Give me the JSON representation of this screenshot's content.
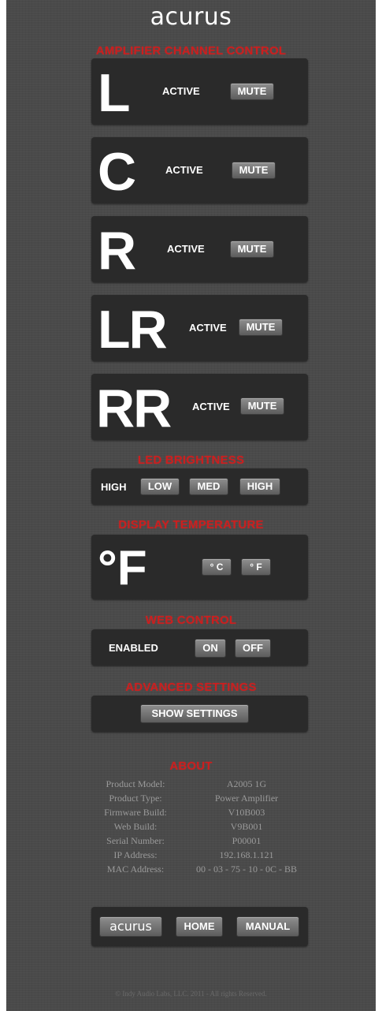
{
  "header": {
    "logo_text": "acurus"
  },
  "amplifier": {
    "title": "AMPLIFIER CHANNEL CONTROL",
    "channels": [
      {
        "label": "L",
        "status": "ACTIVE",
        "mute_label": "MUTE"
      },
      {
        "label": "C",
        "status": "ACTIVE",
        "mute_label": "MUTE"
      },
      {
        "label": "R",
        "status": "ACTIVE",
        "mute_label": "MUTE"
      },
      {
        "label": "LR",
        "status": "ACTIVE",
        "mute_label": "MUTE"
      },
      {
        "label": "RR",
        "status": "ACTIVE",
        "mute_label": "MUTE"
      }
    ]
  },
  "led": {
    "title": "LED BRIGHTNESS",
    "current": "HIGH",
    "options": [
      "LOW",
      "MED",
      "HIGH"
    ]
  },
  "temperature": {
    "title": "DISPLAY TEMPERATURE",
    "current": "°F",
    "celsius_label": "° C",
    "fahrenheit_label": "° F"
  },
  "web_control": {
    "title": "WEB CONTROL",
    "status": "ENABLED",
    "on_label": "ON",
    "off_label": "OFF"
  },
  "advanced": {
    "title": "ADVANCED SETTINGS",
    "button_label": "SHOW SETTINGS"
  },
  "about": {
    "title": "ABOUT",
    "rows": [
      {
        "label": "Product Model:",
        "value": "A2005 1G"
      },
      {
        "label": "Product Type:",
        "value": "Power Amplifier"
      },
      {
        "label": "Firmware Build:",
        "value": "V10B003"
      },
      {
        "label": "Web Build:",
        "value": "V9B001"
      },
      {
        "label": "Serial Number:",
        "value": "P00001"
      },
      {
        "label": "IP Address:",
        "value": "192.168.1.121"
      },
      {
        "label": "MAC Address:",
        "value": "00 - 03 - 75 - 10 - 0C - BB"
      }
    ]
  },
  "nav": {
    "logo_text": "acurus",
    "home_label": "HOME",
    "manual_label": "MANUAL"
  },
  "footer": {
    "copyright": "© Indy Audio Labs, LLC. 2011 - All rights Reserved."
  },
  "colors": {
    "background": "#4a4a4a",
    "panel": "#2a2a2a",
    "section_title": "#cc1e1e",
    "button": "#7a7a7a"
  }
}
